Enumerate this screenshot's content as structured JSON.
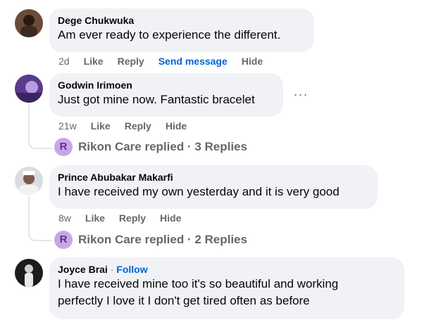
{
  "comments": [
    {
      "author": "Dege Chukwuka",
      "text": "Am ever ready to experience the different.",
      "time": "2d",
      "like": "Like",
      "reply": "Reply",
      "send_message": "Send message",
      "hide": "Hide"
    },
    {
      "author": "Godwin Irimoen",
      "text": "Just got mine now. Fantastic bracelet",
      "time": "21w",
      "like": "Like",
      "reply": "Reply",
      "hide": "Hide",
      "more": "···",
      "replies_author": "R",
      "replies_text": "Rikon Care replied · 3 Replies"
    },
    {
      "author": "Prince Abubakar Makarfi",
      "text": "I have received my own yesterday and it is very good",
      "time": "8w",
      "like": "Like",
      "reply": "Reply",
      "hide": "Hide",
      "replies_author": "R",
      "replies_text": "Rikon Care replied · 2 Replies"
    },
    {
      "author": "Joyce Brai",
      "dot": " · ",
      "follow": "Follow",
      "text_line1": "I have received mine too it's so beautiful and working",
      "text_line2": "perfectly I love it I don't get tired often as before"
    }
  ],
  "colors": {
    "bubble": "#f0f2f5",
    "link_blue": "#0064d1",
    "meta_gray": "#65676b",
    "badge": "#c9a7e6"
  }
}
